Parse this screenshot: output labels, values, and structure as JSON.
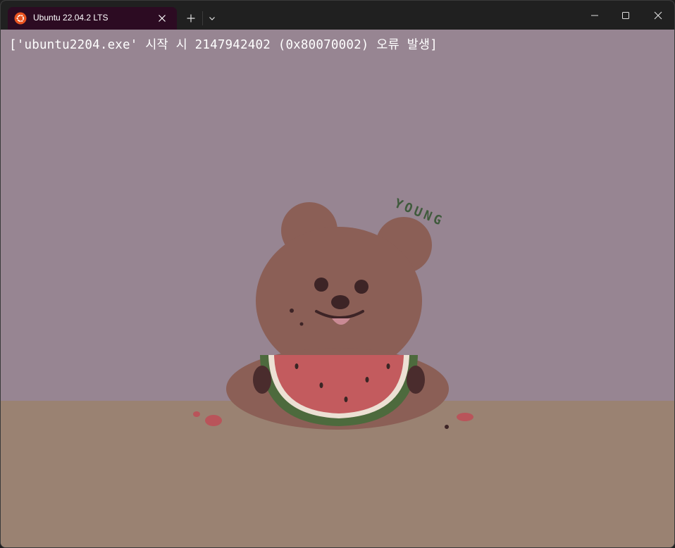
{
  "window": {
    "tab_title": "Ubuntu 22.04.2 LTS",
    "tab_icon": "ubuntu-logo-icon",
    "colors": {
      "titlebar": "#202020",
      "tab": "#2c0b22",
      "ubuntu_orange": "#e95420",
      "terminal_bg": "#978592",
      "floor": "#9a8272"
    }
  },
  "terminal": {
    "lines": [
      "['ubuntu2204.exe' 시작 시 2147942402 (0x80070002) 오류 발생]"
    ]
  },
  "background": {
    "caption": "YOUNG",
    "subject": "teddy-bear-eating-watermelon"
  }
}
